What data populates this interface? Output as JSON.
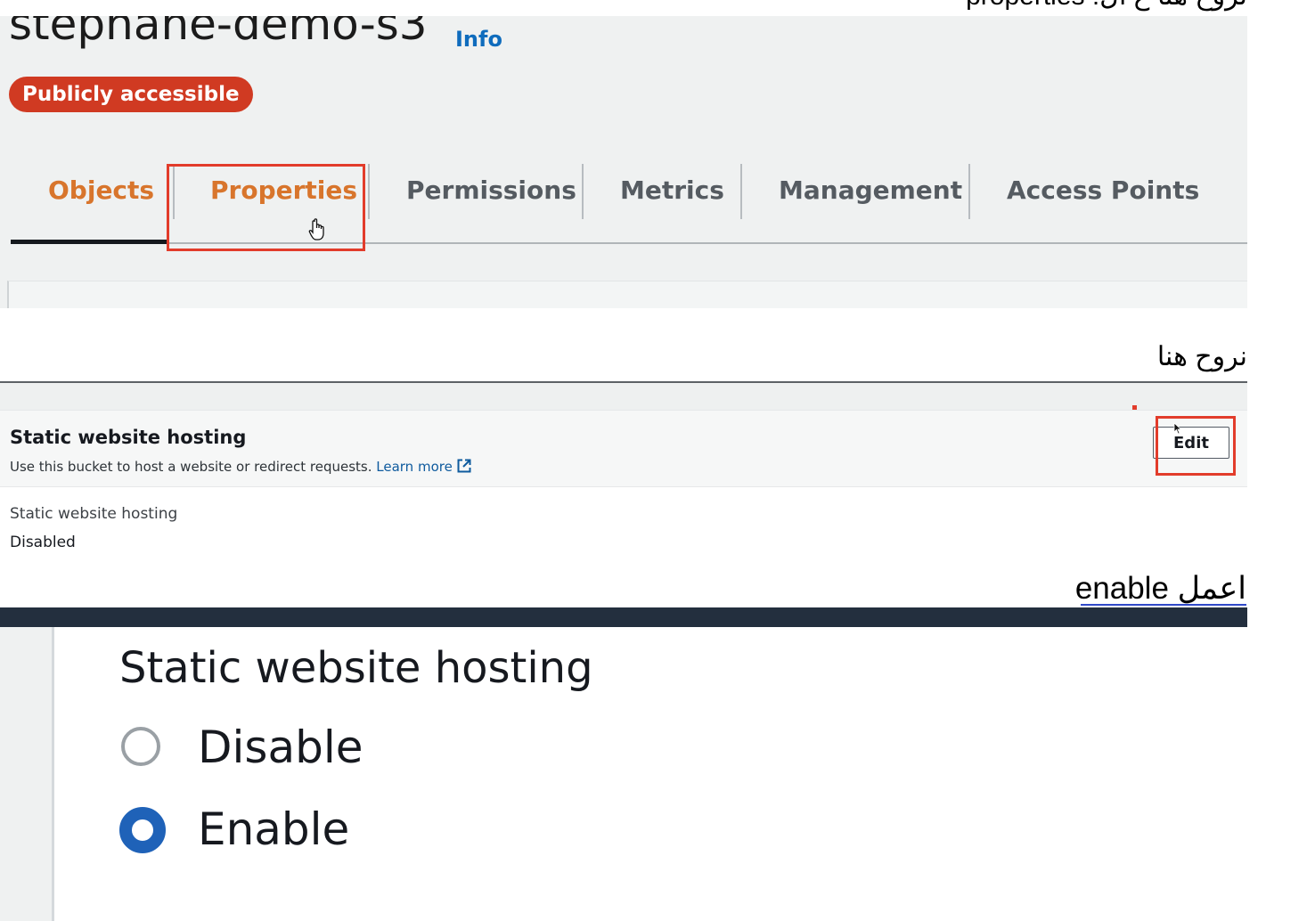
{
  "annotations": {
    "top": "نروح هنا ع ال: properties",
    "middle": "نروح هنا",
    "bottom": "اعمل enable"
  },
  "bucket": {
    "name": "stephane-demo-s3",
    "info_link": "Info",
    "access_badge": "Publicly accessible"
  },
  "tabs": [
    {
      "label": "Objects",
      "state": "selected"
    },
    {
      "label": "Properties",
      "state": "hovered"
    },
    {
      "label": "Permissions"
    },
    {
      "label": "Metrics"
    },
    {
      "label": "Management"
    },
    {
      "label": "Access Points"
    }
  ],
  "static_hosting_section": {
    "title": "Static website hosting",
    "description": "Use this bucket to host a website or redirect requests.",
    "learn_more": "Learn more",
    "edit_button": "Edit",
    "field_label": "Static website hosting",
    "field_value": "Disabled"
  },
  "edit_form": {
    "title": "Static website hosting",
    "options": [
      {
        "label": "Disable",
        "selected": false
      },
      {
        "label": "Enable",
        "selected": true
      }
    ]
  },
  "colors": {
    "highlight_box": "#e23c2b",
    "tab_orange": "#d8752c",
    "link_blue": "#0f6cbd",
    "badge_red": "#d03a22",
    "radio_blue": "#1f62b8"
  },
  "icons": {
    "cursor_hand": "hand-pointer-icon",
    "external_link": "external-link-icon",
    "cursor_arrow": "arrow-cursor-icon"
  }
}
